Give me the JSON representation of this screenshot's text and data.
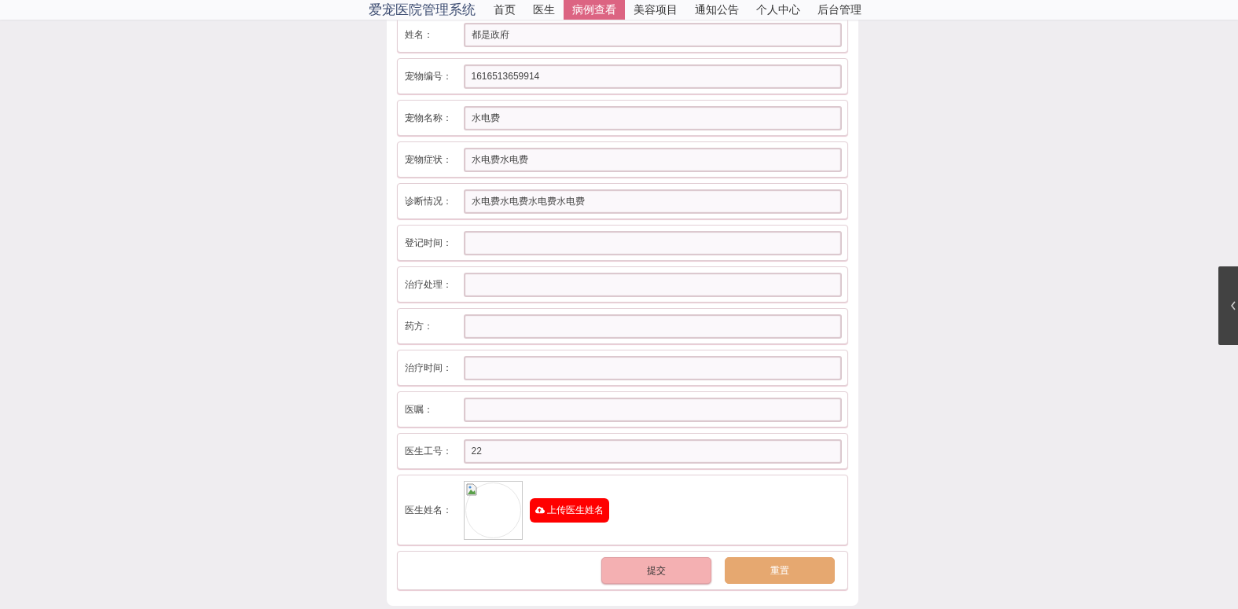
{
  "nav": {
    "title": "爱宠医院管理系统",
    "items": [
      {
        "label": "首页",
        "selected": false
      },
      {
        "label": "医生",
        "selected": false
      },
      {
        "label": "病例查看",
        "selected": true
      },
      {
        "label": "美容项目",
        "selected": false
      },
      {
        "label": "通知公告",
        "selected": false
      },
      {
        "label": "个人中心",
        "selected": false
      },
      {
        "label": "后台管理",
        "selected": false
      }
    ]
  },
  "form": {
    "fields": [
      {
        "kind": "text",
        "label": "姓名：",
        "value": "都是政府"
      },
      {
        "kind": "text",
        "label": "宠物编号：",
        "value": "1616513659914"
      },
      {
        "kind": "text",
        "label": "宠物名称：",
        "value": "水电费"
      },
      {
        "kind": "text",
        "label": "宠物症状：",
        "value": "水电费水电费"
      },
      {
        "kind": "text",
        "label": "诊断情况：",
        "value": "水电费水电费水电费水电费"
      },
      {
        "kind": "text",
        "label": "登记时间："
      },
      {
        "kind": "text",
        "label": "治疗处理："
      },
      {
        "kind": "text",
        "label": "药方："
      },
      {
        "kind": "text",
        "label": "治疗时间："
      },
      {
        "kind": "text",
        "label": "医嘱："
      },
      {
        "kind": "text",
        "label": "医生工号：",
        "value": "22"
      },
      {
        "kind": "image",
        "label": "医生姓名：",
        "button": "上传医生姓名"
      }
    ],
    "actions": [
      {
        "kind": "submit",
        "label": "提交"
      },
      {
        "kind": "reset",
        "label": "重置"
      }
    ]
  }
}
